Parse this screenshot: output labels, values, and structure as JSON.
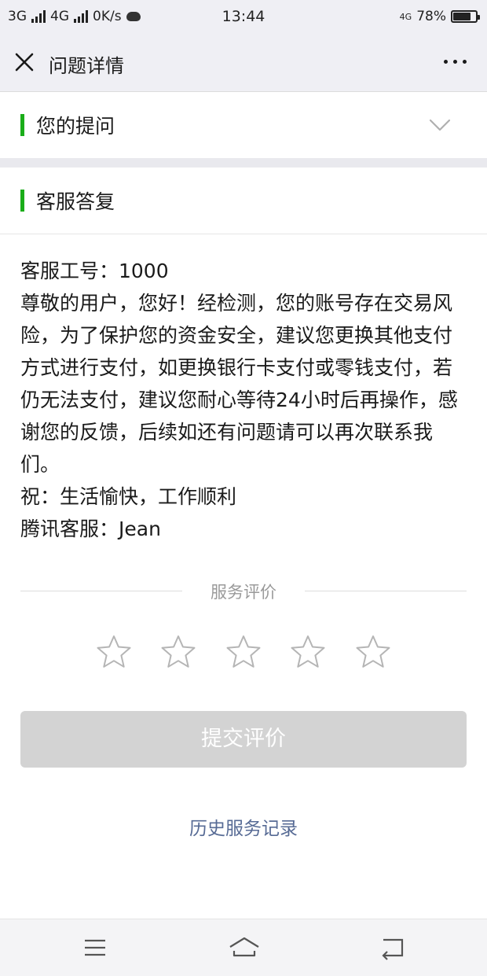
{
  "status": {
    "net1": "3G",
    "net2": "4G",
    "speed": "0K/s",
    "time": "13:44",
    "net_right": "4G",
    "battery": "78%",
    "battery_level": 0.78
  },
  "header": {
    "title": "问题详情",
    "close_icon": "close-icon",
    "more_icon": "more-icon"
  },
  "question": {
    "title": "您的提问",
    "expand_icon": "chevron-down-icon"
  },
  "answer": {
    "title": "客服答复",
    "lines": [
      "客服工号：1000",
      "尊敬的用户，您好！经检测，您的账号存在交易风险，为了保护您的资金安全，建议您更换其他支付方式进行支付，如更换银行卡支付或零钱支付，若仍无法支付，建议您耐心等待24小时后再操作，感谢您的反馈，后续如还有问题请可以再次联系我们。",
      "祝：生活愉快，工作顺利",
      "腾讯客服：Jean"
    ]
  },
  "rating": {
    "label": "服务评价",
    "stars_total": 5,
    "stars_selected": 0,
    "submit_label": "提交评价",
    "history_link": "历史服务记录"
  },
  "colors": {
    "accent_green": "#1aad19",
    "link_blue": "#576b95",
    "disabled_button": "#d3d3d3"
  },
  "navbar": {
    "icons": [
      "menu-icon",
      "home-icon",
      "back-icon"
    ]
  }
}
